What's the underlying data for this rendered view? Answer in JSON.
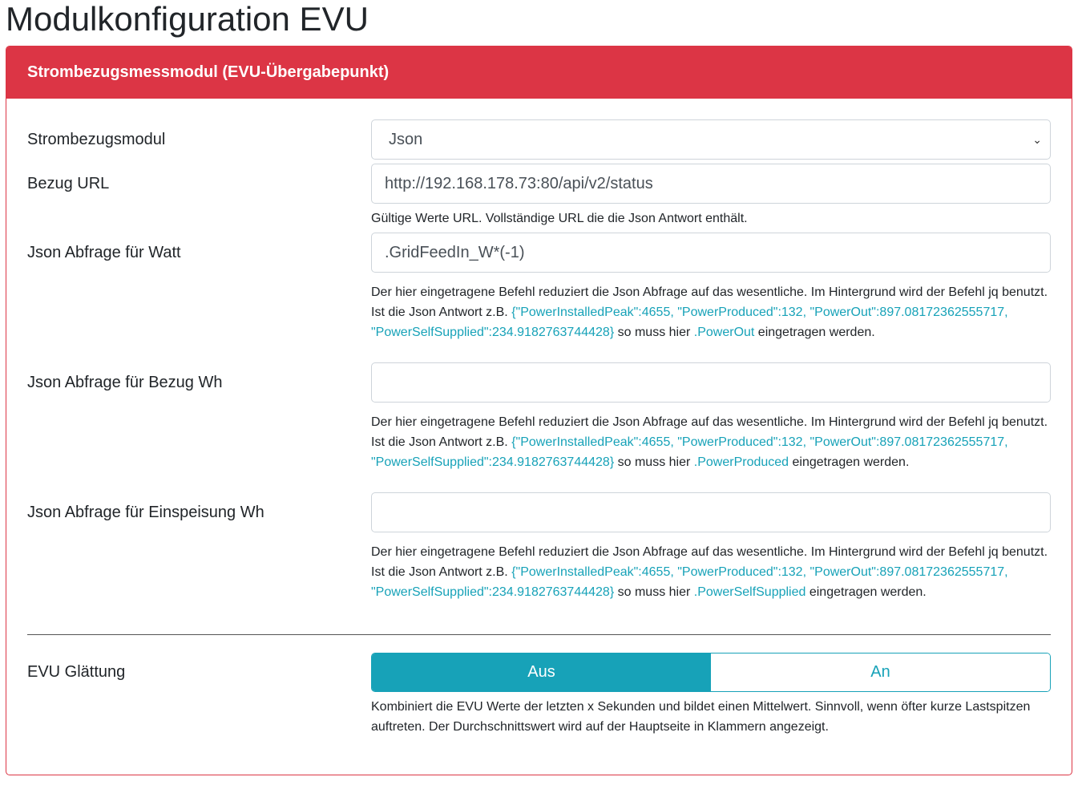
{
  "page_title": "Modulkonfiguration EVU",
  "card_header": "Strombezugsmessmodul (EVU-Übergabepunkt)",
  "modul": {
    "label": "Strombezugsmodul",
    "value": "Json"
  },
  "url": {
    "label": "Bezug URL",
    "value": "http://192.168.178.73:80/api/v2/status",
    "help": "Gültige Werte URL. Vollständige URL die die Json Antwort enthält."
  },
  "common": {
    "help1": "Der hier eingetragene Befehl reduziert die Json Abfrage auf das wesentliche. Im Hintergrund wird der Befehl jq benutzt.",
    "help2": "Ist die Json Antwort z.B. ",
    "example": "{\"PowerInstalledPeak\":4655, \"PowerProduced\":132, \"PowerOut\":897.08172362555717, \"PowerSelfSupplied\":234.9182763744428}",
    "so": " so muss hier ",
    "end": " eingetragen werden."
  },
  "watt": {
    "label": "Json Abfrage für Watt",
    "value": ".GridFeedIn_W*(-1)",
    "key": ".PowerOut"
  },
  "bezug": {
    "label": "Json Abfrage für Bezug Wh",
    "value": "",
    "key": ".PowerProduced"
  },
  "einsp": {
    "label": "Json Abfrage für Einspeisung Wh",
    "value": "",
    "key": ".PowerSelfSupplied"
  },
  "glaettung": {
    "label": "EVU Glättung",
    "off": "Aus",
    "on": "An",
    "help": "Kombiniert die EVU Werte der letzten x Sekunden und bildet einen Mittelwert. Sinnvoll, wenn öfter kurze Lastspitzen auftreten. Der Durchschnittswert wird auf der Hauptseite in Klammern angezeigt."
  },
  "colors": {
    "danger": "#dc3545",
    "info": "#17a2b8"
  }
}
